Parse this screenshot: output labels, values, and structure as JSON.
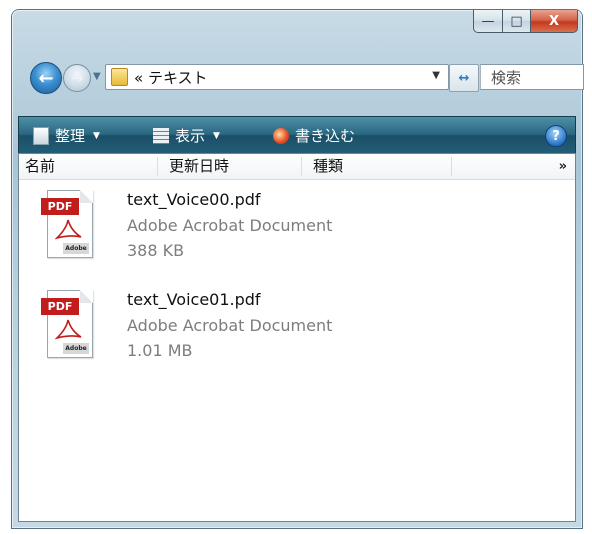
{
  "window": {
    "controls": {
      "minimize": "—",
      "maximize": "□",
      "close": "X"
    }
  },
  "address_bar": {
    "path": "« テキスト",
    "search_placeholder": "検索"
  },
  "command_bar": {
    "organize_label": "整理",
    "views_label": "表示",
    "burn_label": "書き込む",
    "help_label": "?"
  },
  "columns": {
    "name": "名前",
    "date_modified": "更新日時",
    "type": "種類",
    "more": "»"
  },
  "files": [
    {
      "name": "text_Voice00.pdf",
      "type": "Adobe Acrobat Document",
      "size": "388 KB",
      "badge": "PDF",
      "icon_brand": "Adobe",
      "icon": "pdf-file-icon"
    },
    {
      "name": "text_Voice01.pdf",
      "type": "Adobe Acrobat Document",
      "size": "1.01 MB",
      "badge": "PDF",
      "icon_brand": "Adobe",
      "icon": "pdf-file-icon"
    }
  ],
  "colors": {
    "accent_red": "#c11d1d",
    "cmdbar": "#2b6780"
  }
}
